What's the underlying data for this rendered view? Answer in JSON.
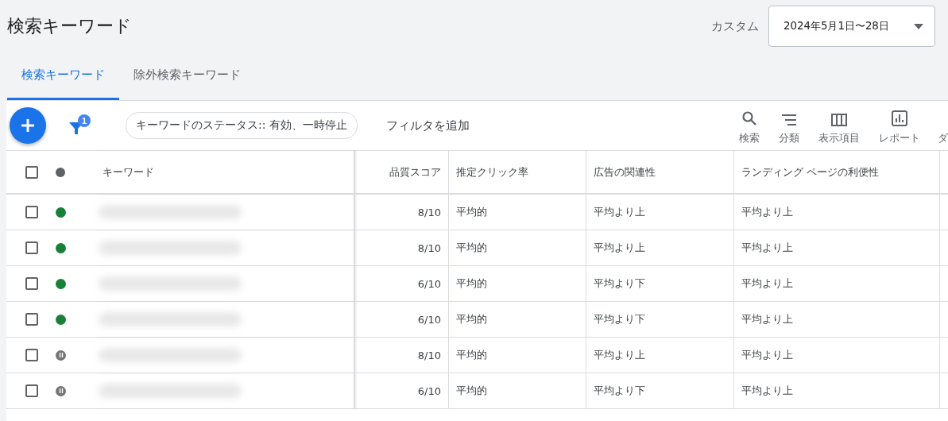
{
  "page": {
    "title": "検索キーワード",
    "range_label": "カスタム",
    "date_range": "2024年5月1日〜28日"
  },
  "tabs": [
    {
      "label": "検索キーワード",
      "selected": true
    },
    {
      "label": "除外検索キーワード",
      "selected": false
    }
  ],
  "toolbar": {
    "filter_count": "1",
    "filter_chip": "キーワードのステータス:: 有効、一時停止",
    "add_filter": "フィルタを追加",
    "actions": [
      {
        "kind": "search",
        "label": "検索"
      },
      {
        "kind": "sort",
        "label": "分類"
      },
      {
        "kind": "columns",
        "label": "表示項目"
      },
      {
        "kind": "report",
        "label": "レポート"
      },
      {
        "kind": "cut",
        "label": "ダ"
      }
    ]
  },
  "table": {
    "select_all_checked": false,
    "columns": [
      "キーワード",
      "品質スコア",
      "推定クリック率",
      "広告の関連性",
      "ランディング ページの利便性"
    ],
    "rows": [
      {
        "checked": false,
        "kind": "enabled",
        "quality": "8/10",
        "ctr": "平均的",
        "relevance": "平均より上",
        "landing": "平均より上"
      },
      {
        "checked": false,
        "kind": "enabled",
        "quality": "8/10",
        "ctr": "平均的",
        "relevance": "平均より上",
        "landing": "平均より上"
      },
      {
        "checked": false,
        "kind": "enabled",
        "quality": "6/10",
        "ctr": "平均的",
        "relevance": "平均より下",
        "landing": "平均より上"
      },
      {
        "checked": false,
        "kind": "enabled",
        "quality": "6/10",
        "ctr": "平均的",
        "relevance": "平均より下",
        "landing": "平均より上"
      },
      {
        "checked": false,
        "kind": "paused",
        "quality": "8/10",
        "ctr": "平均的",
        "relevance": "平均より上",
        "landing": "平均より上"
      },
      {
        "checked": false,
        "kind": "paused",
        "quality": "6/10",
        "ctr": "平均的",
        "relevance": "平均より下",
        "landing": "平均より上"
      }
    ]
  }
}
